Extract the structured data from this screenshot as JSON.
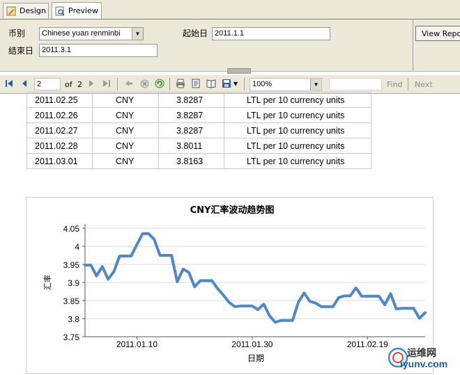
{
  "tabs": [
    {
      "label": "Design",
      "icon": "design-icon"
    },
    {
      "label": "Preview",
      "icon": "preview-icon"
    }
  ],
  "params": {
    "currency_label": "币别",
    "currency_value": "Chinese yuan renminbi",
    "start_label": "起始日",
    "start_value": "2011.1.1",
    "end_label": "结束日",
    "end_value": "2011.3.1",
    "view_report": "View Report"
  },
  "toolbar": {
    "page": "2",
    "of": "of",
    "total_pages": "2",
    "zoom": "100%",
    "find": "Find",
    "next": "Next"
  },
  "table": {
    "rows": [
      [
        "2011.02.25",
        "CNY",
        "3.8287",
        "LTL per 10 currency units"
      ],
      [
        "2011.02.26",
        "CNY",
        "3.8287",
        "LTL per 10 currency units"
      ],
      [
        "2011.02.27",
        "CNY",
        "3.8287",
        "LTL per 10 currency units"
      ],
      [
        "2011.02.28",
        "CNY",
        "3.8011",
        "LTL per 10 currency units"
      ],
      [
        "2011.03.01",
        "CNY",
        "3.8163",
        "LTL per 10 currency units"
      ]
    ]
  },
  "chart_data": {
    "type": "line",
    "title": "CNY汇率波动趋势图",
    "xlabel": "日期",
    "ylabel": "汇率",
    "ylim": [
      3.75,
      4.05
    ],
    "yticks": [
      "3.75",
      "3.8",
      "3.85",
      "3.9",
      "3.95",
      "4",
      "4.05"
    ],
    "xticks": [
      "2011.01.10",
      "2011.01.30",
      "2011.02.19"
    ],
    "xlim": [
      "2011-01-01",
      "2011-03-01"
    ],
    "grid": true,
    "color": "#4f87c9",
    "x": [
      "2011-01-01",
      "2011-01-02",
      "2011-01-03",
      "2011-01-04",
      "2011-01-05",
      "2011-01-06",
      "2011-01-07",
      "2011-01-08",
      "2011-01-09",
      "2011-01-10",
      "2011-01-11",
      "2011-01-12",
      "2011-01-13",
      "2011-01-14",
      "2011-01-15",
      "2011-01-16",
      "2011-01-17",
      "2011-01-18",
      "2011-01-19",
      "2011-01-20",
      "2011-01-21",
      "2011-01-22",
      "2011-01-23",
      "2011-01-24",
      "2011-01-25",
      "2011-01-26",
      "2011-01-27",
      "2011-01-28",
      "2011-01-29",
      "2011-01-30",
      "2011-01-31",
      "2011-02-01",
      "2011-02-02",
      "2011-02-03",
      "2011-02-04",
      "2011-02-05",
      "2011-02-06",
      "2011-02-07",
      "2011-02-08",
      "2011-02-09",
      "2011-02-10",
      "2011-02-11",
      "2011-02-12",
      "2011-02-13",
      "2011-02-14",
      "2011-02-15",
      "2011-02-16",
      "2011-02-17",
      "2011-02-18",
      "2011-02-19",
      "2011-02-20",
      "2011-02-21",
      "2011-02-22",
      "2011-02-23",
      "2011-02-24",
      "2011-02-25",
      "2011-02-26",
      "2011-02-27",
      "2011-02-28",
      "2011-03-01"
    ],
    "values": [
      3.948,
      3.948,
      3.918,
      3.944,
      3.909,
      3.93,
      3.973,
      3.973,
      3.973,
      4.005,
      4.035,
      4.035,
      4.019,
      3.975,
      3.975,
      3.975,
      3.902,
      3.937,
      3.928,
      3.888,
      3.905,
      3.905,
      3.905,
      3.883,
      3.865,
      3.845,
      3.833,
      3.835,
      3.835,
      3.835,
      3.825,
      3.84,
      3.808,
      3.79,
      3.795,
      3.795,
      3.795,
      3.845,
      3.871,
      3.848,
      3.843,
      3.833,
      3.833,
      3.833,
      3.858,
      3.863,
      3.863,
      3.885,
      3.862,
      3.862,
      3.862,
      3.862,
      3.838,
      3.869,
      3.827,
      3.8287,
      3.8287,
      3.8287,
      3.8011,
      3.8163
    ]
  },
  "watermark": {
    "brand": "运维网",
    "url": "iyunv.com"
  }
}
